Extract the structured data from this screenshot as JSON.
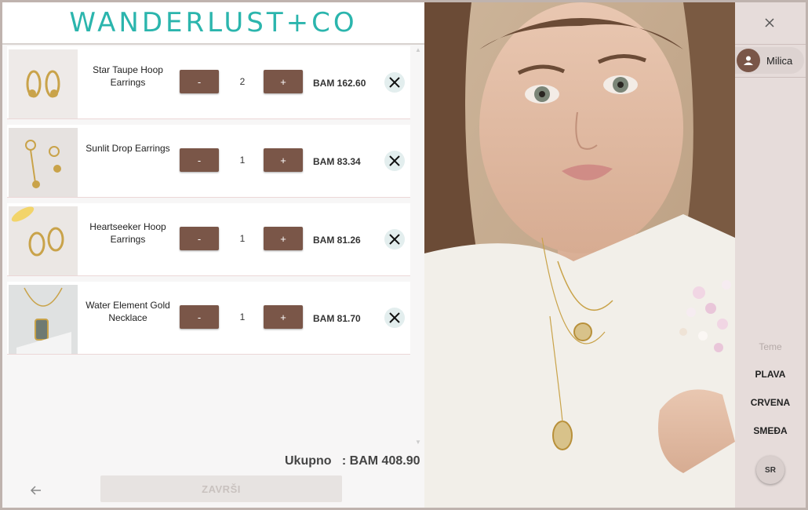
{
  "brand": {
    "logo_text": "WANDERLUST+CO",
    "accent": "#2bb5ad"
  },
  "cart": {
    "items": [
      {
        "name": "Star Taupe Hoop Earrings",
        "qty": "2",
        "price": "BAM 162.60",
        "minus": "-",
        "plus": "+"
      },
      {
        "name": "Sunlit Drop Earrings",
        "qty": "1",
        "price": "BAM 83.34",
        "minus": "-",
        "plus": "+"
      },
      {
        "name": "Heartseeker Hoop Earrings",
        "qty": "1",
        "price": "BAM 81.26",
        "minus": "-",
        "plus": "+"
      },
      {
        "name": "Water Element Gold Necklace",
        "qty": "1",
        "price": "BAM 81.70",
        "minus": "-",
        "plus": "+"
      }
    ],
    "total_label": "Ukupno",
    "total_value": ": BAM 408.90",
    "finish_label": "ZAVRŠI",
    "button_color": "#7a5648"
  },
  "sidebar": {
    "user_name": "Milica",
    "themes_label": "Teme",
    "themes": [
      "PLAVA",
      "CRVENA",
      "SMEĐA"
    ],
    "language": "SR",
    "background": "#e6dcda"
  },
  "icons": [
    "close-icon",
    "person-icon",
    "back-arrow-icon",
    "remove-icon"
  ]
}
